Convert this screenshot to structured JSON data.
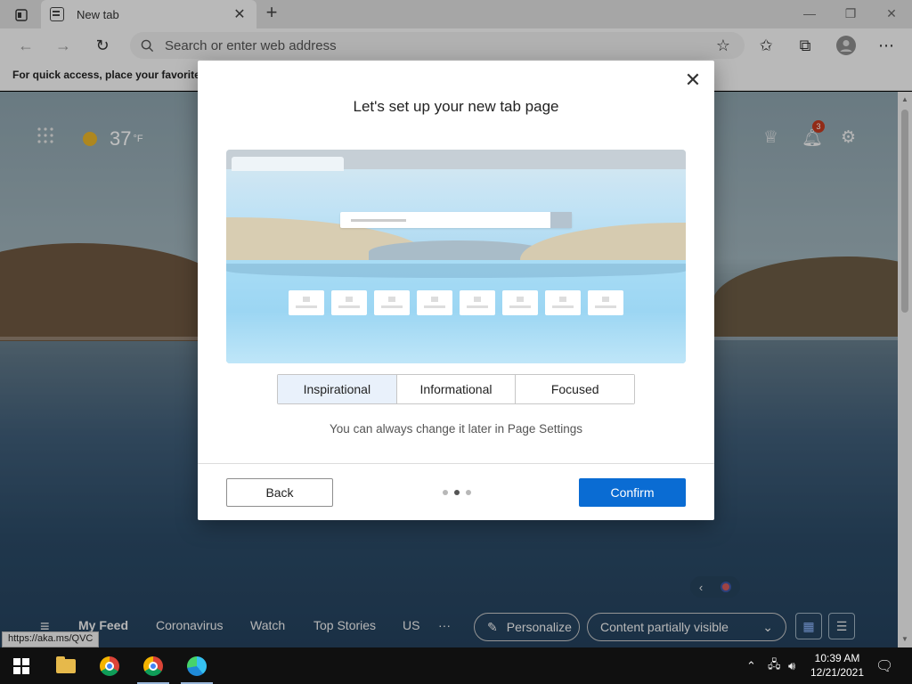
{
  "browser": {
    "tab_title": "New tab",
    "address_placeholder": "Search or enter web address",
    "favorites_bar_text": "For quick access, place your favorites h"
  },
  "newtab": {
    "temperature": "37",
    "temp_unit": "°F",
    "notification_count": "3"
  },
  "feed": {
    "items": [
      "My Feed",
      "Coronavirus",
      "Watch",
      "Top Stories",
      "US"
    ],
    "more": "···",
    "personalize_label": "Personalize",
    "visibility_select": "Content partially visible"
  },
  "status_url": "https://aka.ms/QVC",
  "modal": {
    "title": "Let's set up your new tab page",
    "options": [
      "Inspirational",
      "Informational",
      "Focused"
    ],
    "selected_option": "Inspirational",
    "hint": "You can always change it later in Page Settings",
    "back_label": "Back",
    "confirm_label": "Confirm",
    "step_current": 2,
    "step_total": 3
  },
  "taskbar": {
    "time": "10:39 AM",
    "date": "12/21/2021"
  },
  "colors": {
    "accent": "#0a6cd3",
    "selected_option_bg": "#e9f1fb",
    "badge": "#c33a1f"
  },
  "icons": [
    "tab-actions-icon",
    "new-tab-favicon",
    "close-icon",
    "plus-icon",
    "minimize-icon",
    "restore-icon",
    "back-icon",
    "forward-icon",
    "refresh-icon",
    "search-icon",
    "add-favorite-icon",
    "favorites-icon",
    "collections-icon",
    "profile-icon",
    "more-icon",
    "apps-grid-icon",
    "sun-icon",
    "rewards-icon",
    "bell-icon",
    "gear-icon",
    "pencil-icon",
    "chevron-down-icon",
    "grid-view-icon",
    "list-view-icon",
    "chevron-left-icon",
    "windows-start-icon",
    "file-explorer-icon",
    "chrome-icon",
    "edge-icon"
  ]
}
